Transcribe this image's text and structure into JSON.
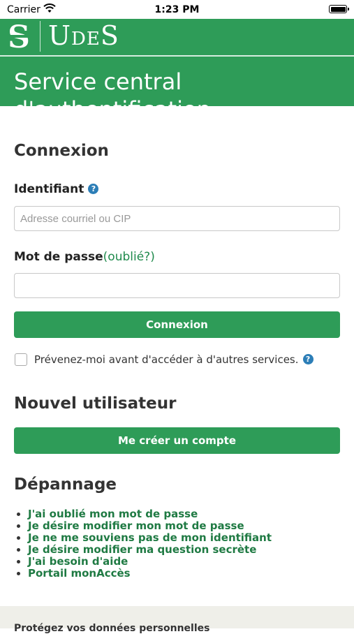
{
  "status_bar": {
    "carrier": "Carrier",
    "time": "1:23 PM"
  },
  "brand": {
    "name_parts": [
      "U",
      "DE",
      "S"
    ]
  },
  "header": {
    "title": "Service central d'authentification"
  },
  "login": {
    "heading": "Connexion",
    "identifier_label": "Identifiant",
    "identifier_placeholder": "Adresse courriel ou CIP",
    "identifier_value": "",
    "password_label": "Mot de passe",
    "forgot_link": "(oublié?)",
    "password_value": "",
    "submit_label": "Connexion",
    "warn_label": "Prévenez-moi avant d'accéder à d'autres services."
  },
  "new_user": {
    "heading": "Nouvel utilisateur",
    "create_label": "Me créer un compte"
  },
  "troubleshooting": {
    "heading": "Dépannage",
    "links": [
      "J'ai oublié mon mot de passe",
      "Je désire modifier mon mot de passe",
      "Je ne me souviens pas de mon identifiant",
      "Je désire modifier ma question secrète",
      "J'ai besoin d'aide",
      "Portail monAccès"
    ]
  },
  "footer": {
    "text": "Protégez vos données personnelles"
  },
  "colors": {
    "brand_green": "#2e9c58",
    "link_green": "#1f8a4c",
    "help_blue": "#2c7eb7"
  }
}
